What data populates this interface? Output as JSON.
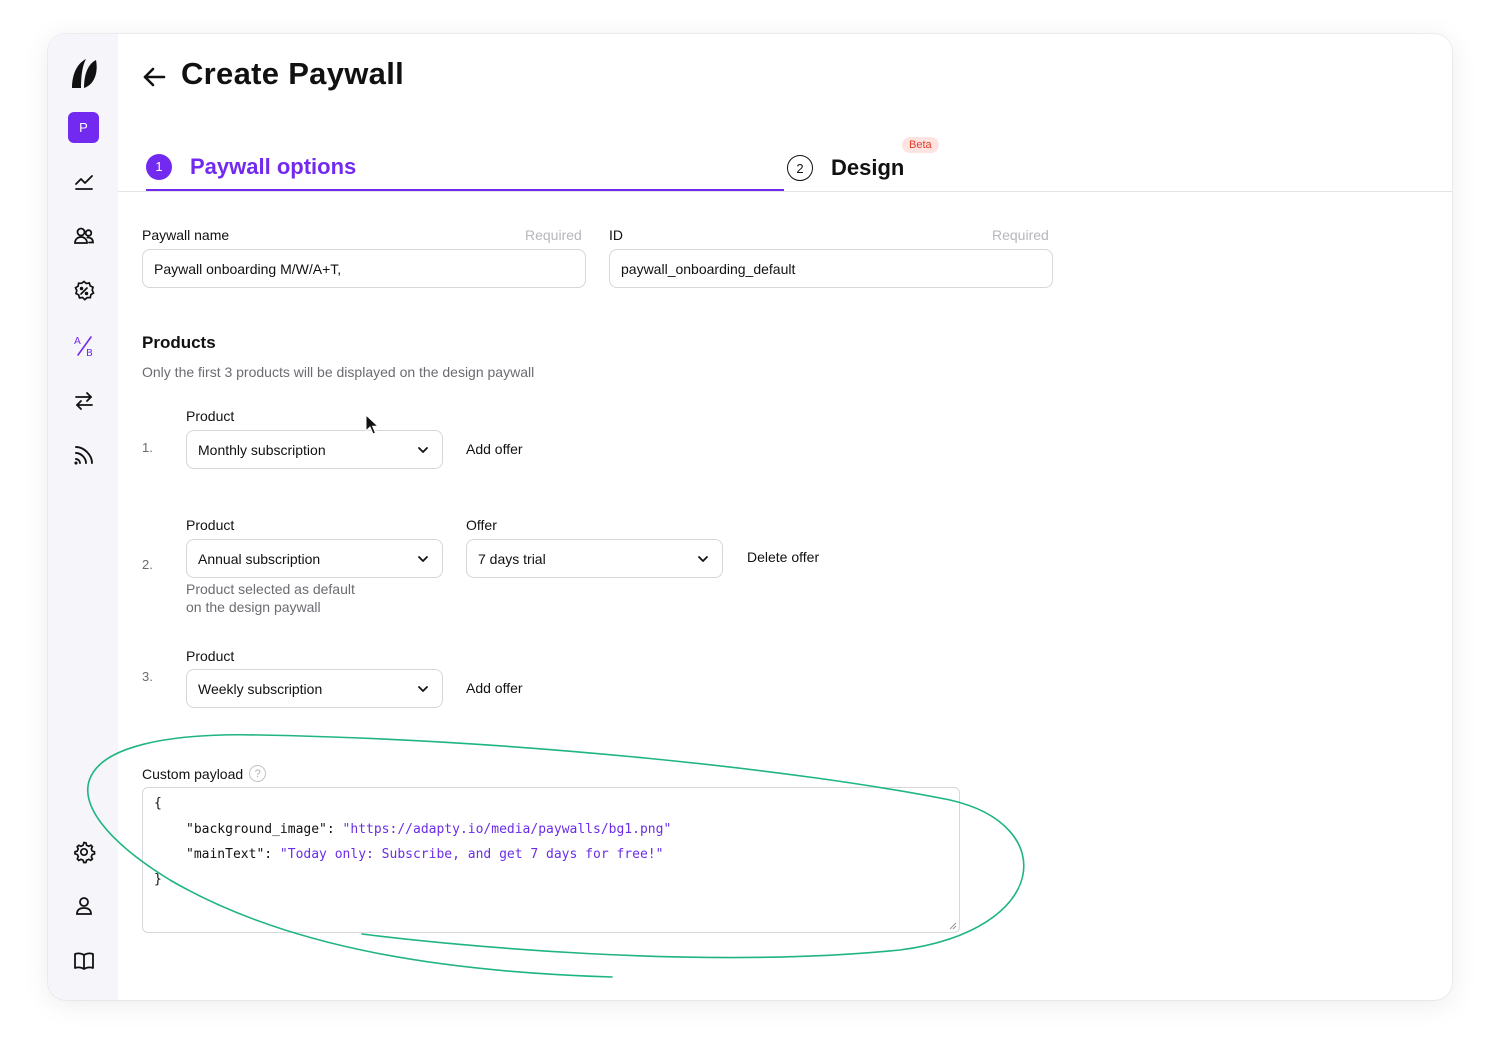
{
  "sidebar": {
    "workspace_initial": "P",
    "items": [
      {
        "name": "analytics-icon"
      },
      {
        "name": "profiles-icon"
      },
      {
        "name": "promo-icon"
      },
      {
        "name": "ab-test-icon"
      },
      {
        "name": "transfer-icon"
      },
      {
        "name": "feed-icon"
      }
    ],
    "bottom_items": [
      {
        "name": "settings-icon"
      },
      {
        "name": "account-icon"
      },
      {
        "name": "docs-icon"
      }
    ]
  },
  "header": {
    "title": "Create Paywall"
  },
  "tabs": [
    {
      "number": "1",
      "label": "Paywall options",
      "active": true
    },
    {
      "number": "2",
      "label": "Design",
      "badge": "Beta",
      "active": false
    }
  ],
  "form": {
    "paywall_name": {
      "label": "Paywall name",
      "required": "Required",
      "value": "Paywall onboarding M/W/A+T,"
    },
    "id": {
      "label": "ID",
      "required": "Required",
      "value": "paywall_onboarding_default"
    }
  },
  "products": {
    "title": "Products",
    "subtitle": "Only the first 3 products will be displayed on the design paywall",
    "rows": [
      {
        "num": "1.",
        "product_label": "Product",
        "product": "Monthly subscription",
        "action": "Add offer"
      },
      {
        "num": "2.",
        "product_label": "Product",
        "product": "Annual subscription",
        "offer_label": "Offer",
        "offer": "7 days trial",
        "action": "Delete offer",
        "hint_line1": "Product selected as default",
        "hint_line2": "on the design paywall"
      },
      {
        "num": "3.",
        "product_label": "Product",
        "product": "Weekly subscription",
        "action": "Add offer"
      }
    ]
  },
  "payload": {
    "label": "Custom payload",
    "help": "?",
    "open_brace": "{",
    "key1": "\"background_image\": ",
    "val1": "\"https://adapty.io/media/paywalls/bg1.png\"",
    "key2": "\"mainText\": ",
    "val2": "\"Today only: Subscribe, and get 7 days for free!\"",
    "close_brace": "}"
  },
  "colors": {
    "accent": "#7229f0",
    "beta_bg": "#fde4e1",
    "beta_text": "#e23b2a",
    "annotation": "#1fb57e"
  }
}
